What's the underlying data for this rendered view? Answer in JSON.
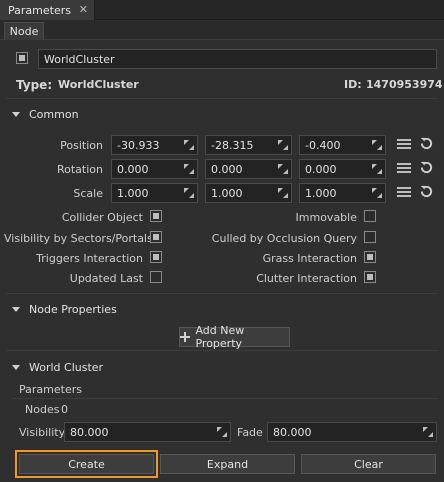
{
  "window": {
    "tab_title": "Parameters",
    "close_glyph": "✕"
  },
  "subtab": {
    "label": "Node"
  },
  "node": {
    "name": "WorldCluster",
    "enabled": true,
    "type_label": "Type:",
    "type_value": "WorldCluster",
    "id_label": "ID:",
    "id_value": "1470953974"
  },
  "common": {
    "header": "Common",
    "position": {
      "label": "Position",
      "x": "-30.933",
      "y": "-28.315",
      "z": "-0.400"
    },
    "rotation": {
      "label": "Rotation",
      "x": "0.000",
      "y": "0.000",
      "z": "0.000"
    },
    "scale": {
      "label": "Scale",
      "x": "1.000",
      "y": "1.000",
      "z": "1.000"
    },
    "flags_left": [
      {
        "label": "Collider Object",
        "checked": true
      },
      {
        "label": "Visibility by Sectors/Portals",
        "checked": true
      },
      {
        "label": "Triggers Interaction",
        "checked": true
      },
      {
        "label": "Updated Last",
        "checked": false
      }
    ],
    "flags_right": [
      {
        "label": "Immovable",
        "checked": false
      },
      {
        "label": "Culled by Occlusion Query",
        "checked": false
      },
      {
        "label": "Grass Interaction",
        "checked": true
      },
      {
        "label": "Clutter Interaction",
        "checked": true
      }
    ]
  },
  "node_properties": {
    "header": "Node Properties",
    "add_button": "Add New Property"
  },
  "world_cluster": {
    "header": "World Cluster",
    "params_title": "Parameters",
    "nodes_label": "Nodes",
    "nodes_value": "0",
    "visibility_label": "Visibility",
    "visibility_value": "80.000",
    "fade_label": "Fade",
    "fade_value": "80.000",
    "create_button": "Create",
    "expand_button": "Expand",
    "clear_button": "Clear"
  }
}
